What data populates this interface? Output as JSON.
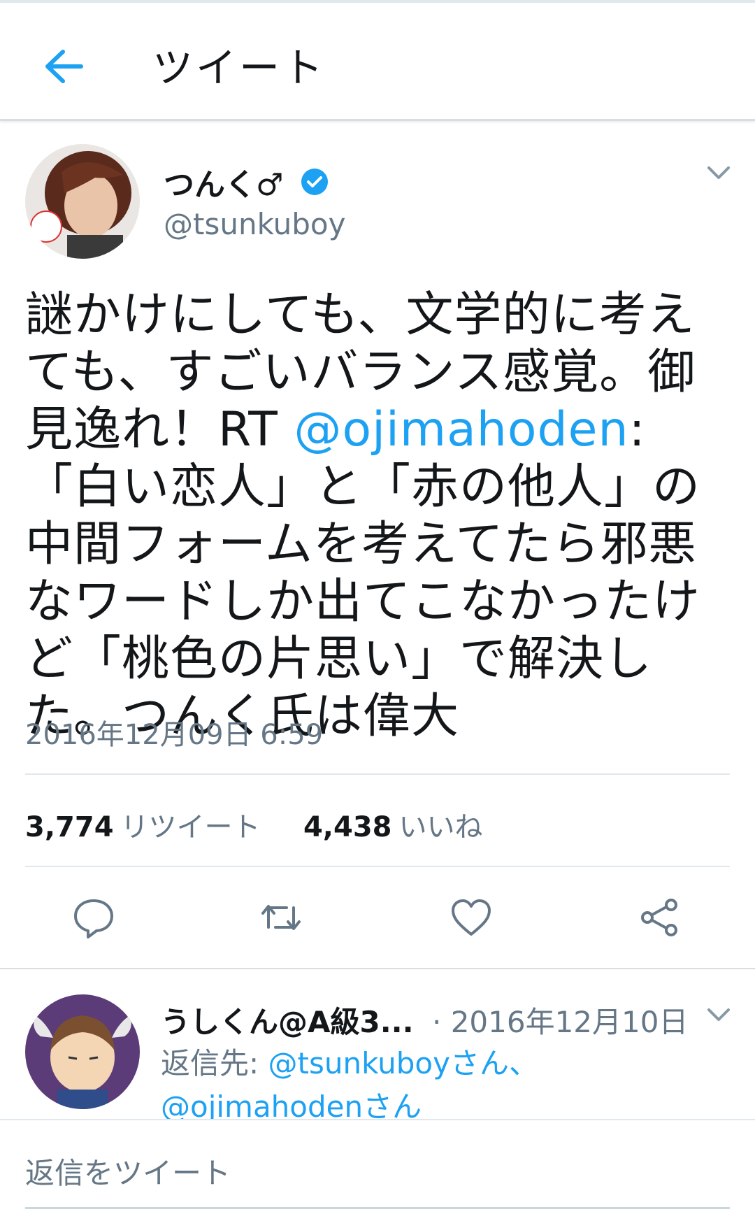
{
  "header": {
    "title": "ツイート"
  },
  "tweet": {
    "author_name": "つんく♂",
    "handle": "@tsunkuboy",
    "text_before": "謎かけにしても、文学的に考えても、すごいバランス感覚。御見逸れ！RT ",
    "mention": "@ojimahoden",
    "text_after": ": 「白い恋人」と「赤の他人」の中間フォームを考えてたら邪悪なワードしか出てこなかったけど「桃色の片思い」で解決した。つんく氏は偉大",
    "timestamp": "2016年12月09日 6:59",
    "retweet_count": "3,774",
    "retweet_label": "リツイート",
    "like_count": "4,438",
    "like_label": "いいね"
  },
  "reply": {
    "name": "うしくん@A級3...",
    "date": "· 2016年12月10日",
    "reply_prefix": "返信先: ",
    "reply_mention1": "@tsunkuboyさん、",
    "reply_mention2": "@ojimahodenさん"
  },
  "compose": {
    "placeholder": "返信をツイート"
  },
  "colors": {
    "accent": "#1da1f2",
    "secondary_text": "#657786",
    "primary_text": "#14171a",
    "divider": "#e1e8ed"
  }
}
